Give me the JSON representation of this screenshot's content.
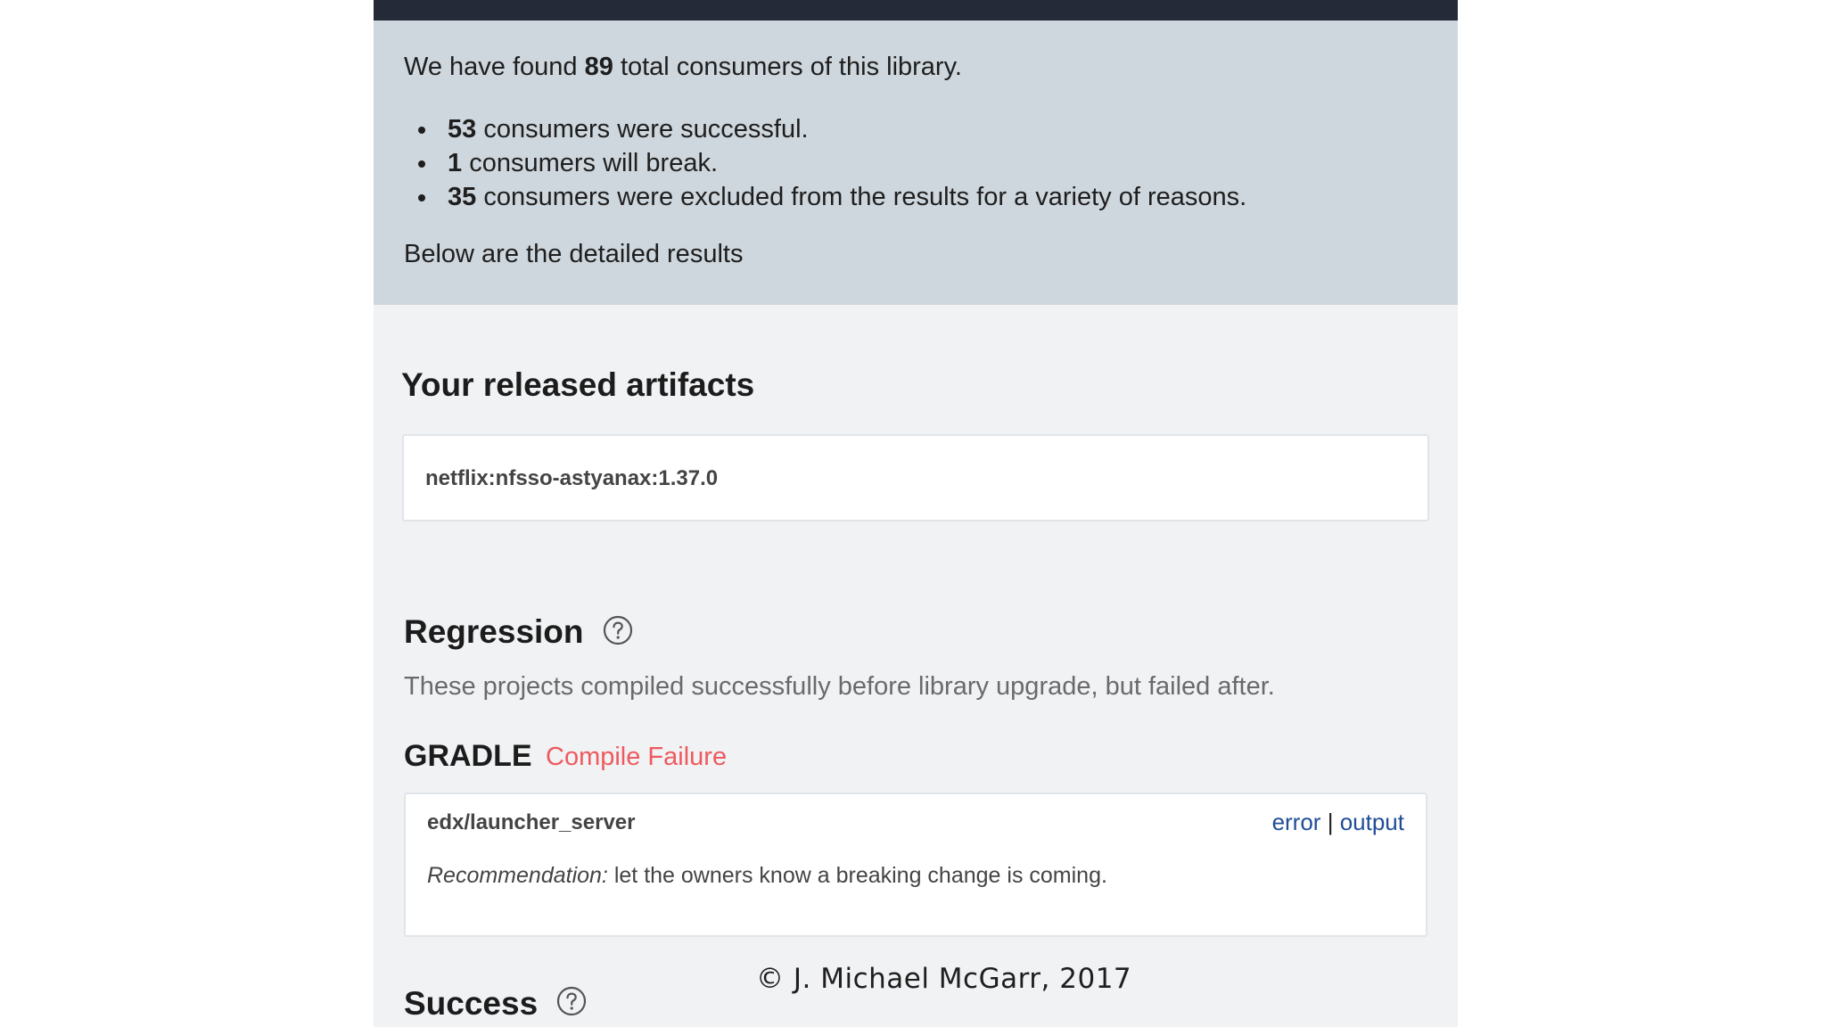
{
  "summary": {
    "intro_prefix": "We have found",
    "total_count": "89",
    "intro_suffix": "total consumers of this library.",
    "bullets": [
      {
        "count": "53",
        "text": "consumers were successful."
      },
      {
        "count": "1",
        "text": "consumers will break."
      },
      {
        "count": "35",
        "text": "consumers were excluded from the results for a variety of reasons."
      }
    ],
    "detail_note": "Below are the detailed results"
  },
  "artifacts": {
    "title": "Your released artifacts",
    "items": [
      "netflix:nfsso-astyanax:1.37.0"
    ]
  },
  "regression": {
    "title": "Regression",
    "help_icon": "question-circle-icon",
    "description": "These projects compiled successfully before library upgrade, but failed after.",
    "build_tool": "GRADLE",
    "status": "Compile Failure",
    "status_color": "#ee5a5f",
    "results": [
      {
        "project": "edx/launcher_server",
        "error_link": "error",
        "separator": "|",
        "output_link": "output",
        "recommendation_label": "Recommendation:",
        "recommendation_text": "let the owners know a breaking change is coming."
      }
    ]
  },
  "success": {
    "title": "Success",
    "help_icon": "question-circle-icon"
  },
  "footer": {
    "copyright": "© J. Michael McGarr, 2017"
  },
  "colors": {
    "top_bar": "#252a38",
    "summary_bg": "#cfd7de",
    "page_bg": "#f1f2f4",
    "link": "#214d96"
  }
}
